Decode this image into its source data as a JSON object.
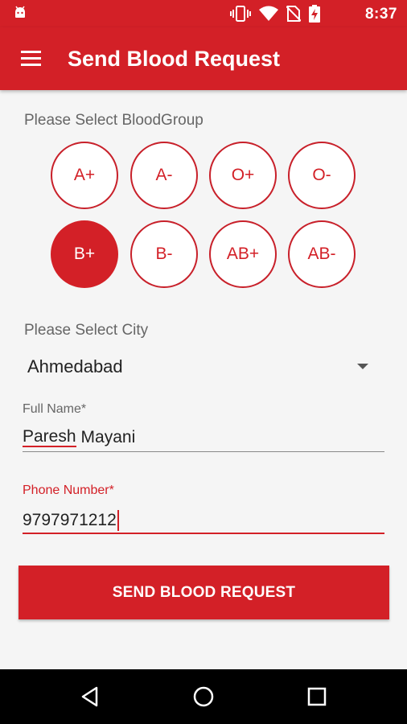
{
  "status_bar": {
    "time": "8:37"
  },
  "app_bar": {
    "title": "Send Blood Request"
  },
  "blood_group": {
    "label": "Please Select BloodGroup",
    "options": [
      "A+",
      "A-",
      "O+",
      "O-",
      "B+",
      "B-",
      "AB+",
      "AB-"
    ],
    "selected": "B+"
  },
  "city": {
    "label": "Please Select City",
    "value": "Ahmedabad"
  },
  "full_name": {
    "label": "Full Name*",
    "value_first": "Paresh",
    "value_last": "Mayani"
  },
  "phone": {
    "label": "Phone Number*",
    "value": "9797971212"
  },
  "send_button": {
    "label": "SEND BLOOD REQUEST"
  },
  "colors": {
    "primary": "#d32027",
    "background": "#f5f5f5",
    "label": "#666666"
  },
  "icons": {
    "status": [
      "android-icon",
      "vibrate-icon",
      "wifi-icon",
      "no-sim-icon",
      "battery-charging-icon"
    ],
    "nav": [
      "back-icon",
      "home-icon",
      "recents-icon"
    ]
  }
}
